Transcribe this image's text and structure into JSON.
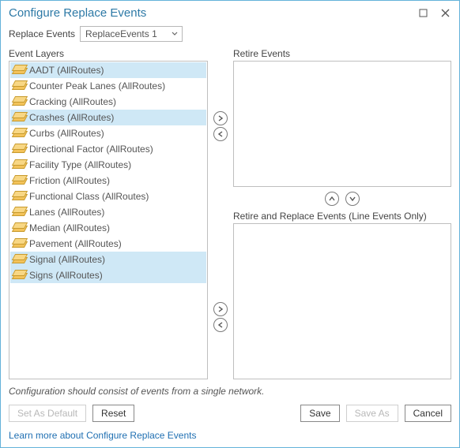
{
  "window": {
    "title": "Configure Replace Events"
  },
  "selector": {
    "label": "Replace Events",
    "value": "ReplaceEvents 1"
  },
  "labels": {
    "event_layers": "Event Layers",
    "retire_events": "Retire Events",
    "retire_replace": "Retire and Replace Events (Line Events Only)"
  },
  "event_layers": [
    {
      "label": "AADT (AllRoutes)",
      "selected": true
    },
    {
      "label": "Counter Peak Lanes (AllRoutes)",
      "selected": false
    },
    {
      "label": "Cracking (AllRoutes)",
      "selected": false
    },
    {
      "label": "Crashes (AllRoutes)",
      "selected": true
    },
    {
      "label": "Curbs (AllRoutes)",
      "selected": false
    },
    {
      "label": "Directional Factor (AllRoutes)",
      "selected": false
    },
    {
      "label": "Facility Type (AllRoutes)",
      "selected": false
    },
    {
      "label": "Friction (AllRoutes)",
      "selected": false
    },
    {
      "label": "Functional Class (AllRoutes)",
      "selected": false
    },
    {
      "label": "Lanes (AllRoutes)",
      "selected": false
    },
    {
      "label": "Median (AllRoutes)",
      "selected": false
    },
    {
      "label": "Pavement (AllRoutes)",
      "selected": false
    },
    {
      "label": "Signal (AllRoutes)",
      "selected": true
    },
    {
      "label": "Signs (AllRoutes)",
      "selected": true
    }
  ],
  "retire_events": [],
  "retire_replace_events": [],
  "hint": "Configuration should consist of events from a single network.",
  "buttons": {
    "set_as_default": "Set As Default",
    "reset": "Reset",
    "save": "Save",
    "save_as": "Save As",
    "cancel": "Cancel"
  },
  "link": "Learn more about Configure Replace Events"
}
